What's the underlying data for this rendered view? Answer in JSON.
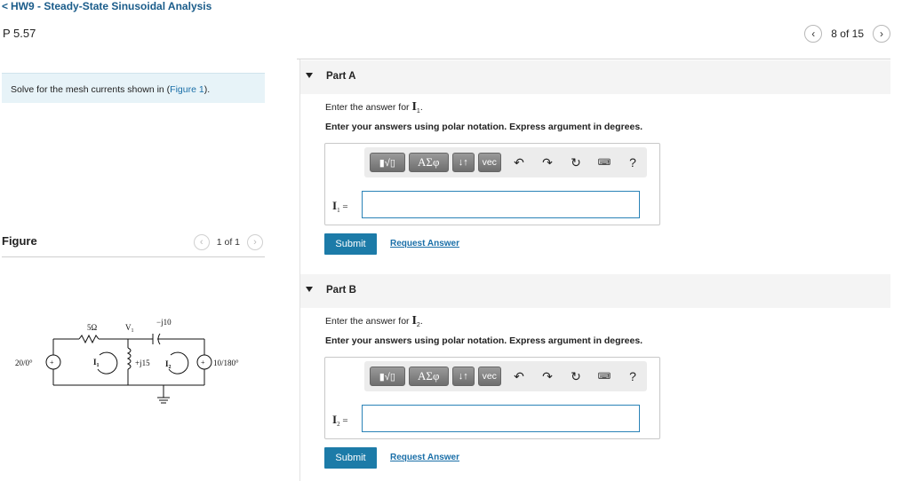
{
  "header": {
    "back_title": "HW9 - Steady-State Sinusoidal Analysis",
    "problem": "P 5.57",
    "pager_text": "8 of 15"
  },
  "left": {
    "prompt_before": "Solve for the mesh currents shown in (",
    "prompt_link": "Figure 1",
    "prompt_after": ").",
    "figure_label": "Figure",
    "figure_pager": "1 of 1"
  },
  "circuit": {
    "r_label": "5Ω",
    "v1_label": "V",
    "v1_sub": "1",
    "cap_label": "−j10",
    "ind_label": "+j15",
    "src1_label": "20/0°",
    "src2_label": "10/180°",
    "i1_label": "I",
    "i1_sub": "1",
    "i2_label": "I",
    "i2_sub": "2"
  },
  "parts": [
    {
      "title": "Part A",
      "enter_prefix": "Enter the answer for ",
      "var": "I",
      "var_sub": "1",
      "enter_suffix": ".",
      "instruction": "Enter your answers using polar notation. Express argument in degrees.",
      "label": "I",
      "label_sub": "1",
      "eq": " =",
      "submit": "Submit",
      "request": "Request Answer"
    },
    {
      "title": "Part B",
      "enter_prefix": "Enter the answer for ",
      "var": "I",
      "var_sub": "2",
      "enter_suffix": ".",
      "instruction": "Enter your answers using polar notation. Express argument in degrees.",
      "label": "I",
      "label_sub": "2",
      "eq": " =",
      "submit": "Submit",
      "request": "Request Answer"
    }
  ],
  "toolbar": {
    "greek": "ΑΣφ",
    "sort": "↓↑",
    "vec": "vec",
    "help": "?",
    "icons": [
      "templates-icon",
      "greek-icon",
      "sort-icon",
      "vec-icon",
      "undo-icon",
      "redo-icon",
      "reset-icon",
      "keyboard-icon",
      "help-icon"
    ]
  }
}
